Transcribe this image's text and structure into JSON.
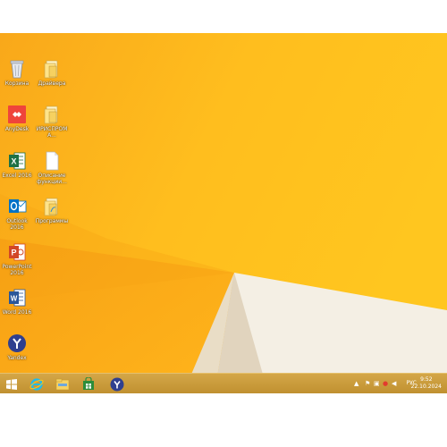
{
  "desktop": {
    "icons": [
      {
        "label": "Корзина",
        "icon": "recycle-bin-icon"
      },
      {
        "label": "Драйвера",
        "icon": "folder-icon"
      },
      {
        "label": "AnyDesk",
        "icon": "anydesk-icon"
      },
      {
        "label": "ИРИСПРОМА...",
        "icon": "folder-icon"
      },
      {
        "label": "Excel 2016",
        "icon": "excel-icon"
      },
      {
        "label": "Описание функции...",
        "icon": "document-icon"
      },
      {
        "label": "Outlook 2016",
        "icon": "outlook-icon"
      },
      {
        "label": "Программы",
        "icon": "folder-icon"
      },
      {
        "label": "PowerPoint 2016",
        "icon": "powerpoint-icon"
      },
      {
        "label": "Word 2016",
        "icon": "word-icon"
      },
      {
        "label": "Yandex",
        "icon": "yandex-browser-icon"
      }
    ]
  },
  "taskbar": {
    "pinned": [
      {
        "name": "start",
        "icon": "windows-start-icon"
      },
      {
        "name": "internet-explorer",
        "icon": "internet-explorer-icon"
      },
      {
        "name": "file-explorer",
        "icon": "file-explorer-icon"
      },
      {
        "name": "store",
        "icon": "windows-store-icon"
      },
      {
        "name": "yandex",
        "icon": "yandex-browser-icon"
      }
    ],
    "tray": {
      "language": "РУС",
      "time": "9:52",
      "date": "22.10.2024"
    }
  },
  "colors": {
    "wallpaper_light": "#ffc21a",
    "wallpaper_dark": "#f29c12",
    "taskbar": "#c99b3a",
    "wedge_light": "#f6efe3",
    "wedge_shadow": "#d8c7ad"
  }
}
